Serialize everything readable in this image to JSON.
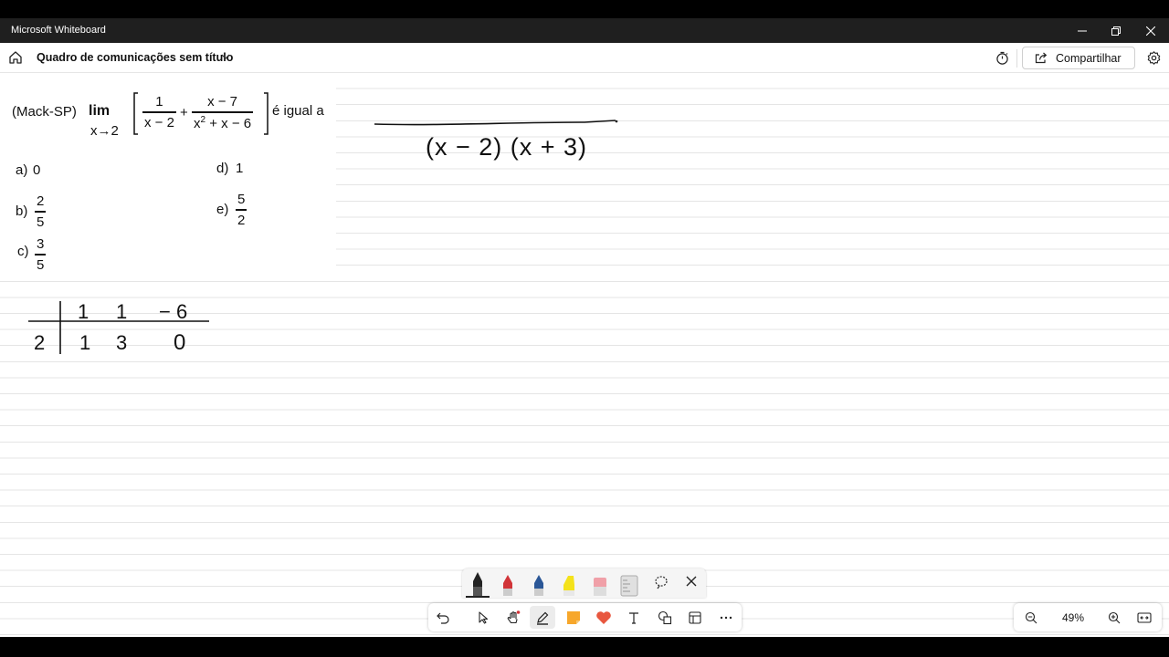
{
  "window": {
    "app_title": "Microsoft Whiteboard"
  },
  "header": {
    "board_title": "Quadro de comunicações sem título",
    "share_label": "Compartilhar"
  },
  "problem": {
    "source": "(Mack-SP)",
    "lim": "lim",
    "lim_sub": "x→2",
    "frac1_num": "1",
    "frac1_den": "x − 2",
    "plus": "+",
    "frac2_num": "x − 7",
    "frac2_den_a": "x",
    "frac2_den_exp": "2",
    "frac2_den_b": " + x − 6",
    "tail": "é igual a",
    "options": {
      "a_label": "a)",
      "a_value": "0",
      "b_label": "b)",
      "b_num": "2",
      "b_den": "5",
      "c_label": "c)",
      "c_num": "3",
      "c_den": "5",
      "d_label": "d)",
      "d_value": "1",
      "e_label": "e)",
      "e_num": "5",
      "e_den": "2"
    }
  },
  "handwriting": {
    "denominator": "(x − 2) (x + 3)",
    "briot_coeffs": [
      "1",
      "1",
      "− 6"
    ],
    "briot_root": "2",
    "briot_results": [
      "1",
      "3",
      "0"
    ]
  },
  "zoom": {
    "level": "49%"
  },
  "icons": {
    "home": "home-icon",
    "chevron": "chevron-down-icon",
    "timer": "timer-icon",
    "share": "share-icon",
    "settings": "gear-icon",
    "minimize": "minimize-icon",
    "restore": "restore-icon",
    "close": "close-icon"
  },
  "colors": {
    "pen_black": "#222222",
    "pen_red": "#d13438",
    "pen_blue": "#2b5797",
    "highlighter": "#f4e21b",
    "accent": "#e74c3c"
  }
}
